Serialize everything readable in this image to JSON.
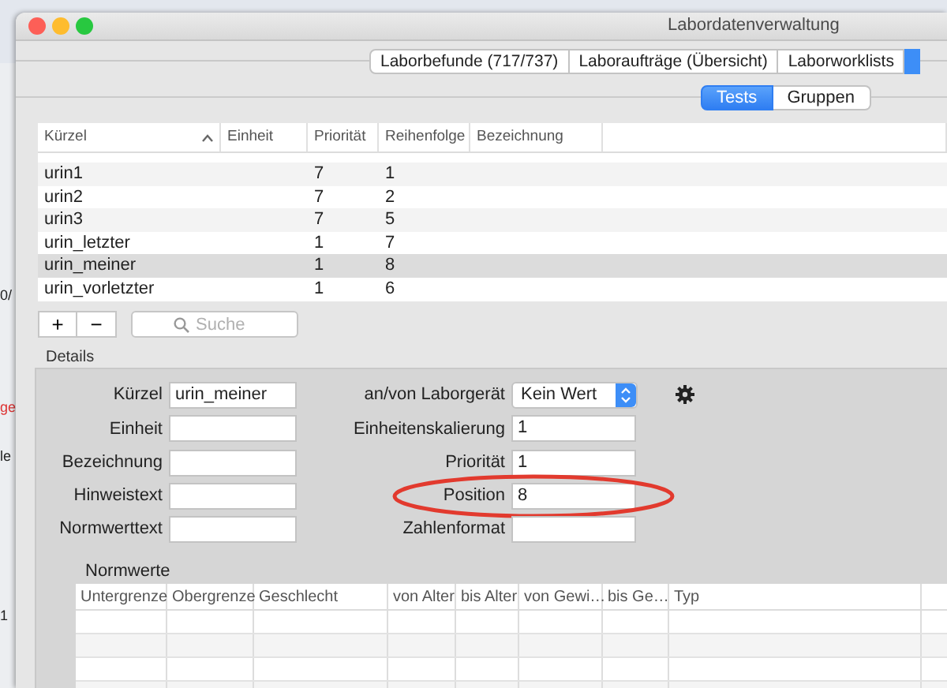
{
  "window": {
    "title": "Labordatenverwaltung"
  },
  "background_window": {
    "fragments": [
      {
        "text": "0/",
        "kind": "plain"
      },
      {
        "text": "ge",
        "kind": "alert"
      },
      {
        "text": "le",
        "kind": "plain"
      },
      {
        "text": "1",
        "kind": "plain"
      }
    ]
  },
  "tabs": [
    {
      "label": "Laborbefunde (717/737)",
      "selected": false
    },
    {
      "label": "Laboraufträge (Übersicht)",
      "selected": false
    },
    {
      "label": "Laborworklists",
      "selected": false
    },
    {
      "selected": true
    }
  ],
  "segments": [
    {
      "label": "Tests",
      "selected": true
    },
    {
      "label": "Gruppen",
      "selected": false
    }
  ],
  "tests_table": {
    "columns": [
      {
        "label": "Kürzel",
        "sorted": true
      },
      {
        "label": "Einheit",
        "sorted": false
      },
      {
        "label": "Priorität",
        "sorted": false
      },
      {
        "label": "Reihenfolge",
        "sorted": false
      },
      {
        "label": "Bezeichnung",
        "sorted": false
      }
    ],
    "rows": [
      {
        "kuerzel": "urin1",
        "prioritaet": "7",
        "reihenfolge": "1",
        "selected": false
      },
      {
        "kuerzel": "urin2",
        "prioritaet": "7",
        "reihenfolge": "2",
        "selected": false
      },
      {
        "kuerzel": "urin3",
        "prioritaet": "7",
        "reihenfolge": "5",
        "selected": false
      },
      {
        "kuerzel": "urin_letzter",
        "prioritaet": "1",
        "reihenfolge": "7",
        "selected": false
      },
      {
        "kuerzel": "urin_meiner",
        "prioritaet": "1",
        "reihenfolge": "8",
        "selected": true
      },
      {
        "kuerzel": "urin_vorletzter",
        "prioritaet": "1",
        "reihenfolge": "6",
        "selected": false
      }
    ]
  },
  "table_toolbar": {
    "add": "+",
    "remove": "−",
    "search": {
      "placeholder": "Suche"
    }
  },
  "details": {
    "title": "Details",
    "left_fields": [
      {
        "label": "Kürzel",
        "value": "urin_meiner"
      },
      {
        "label": "Einheit"
      },
      {
        "label": "Bezeichnung"
      },
      {
        "label": "Hinweistext"
      },
      {
        "label": "Normwerttext"
      }
    ],
    "right_fields": [
      {
        "label": "an/von Laborgerät",
        "kind": "popup",
        "value": "Kein Wert",
        "highlighted": false
      },
      {
        "label": "Einheitenskalierung",
        "kind": "text",
        "value": "1",
        "highlighted": false
      },
      {
        "label": "Priorität",
        "kind": "text",
        "value": "1",
        "highlighted": false
      },
      {
        "label": "Position",
        "kind": "text",
        "value": "8",
        "highlighted": true
      },
      {
        "label": "Zahlenformat",
        "kind": "text",
        "highlighted": false
      }
    ]
  },
  "normwerte": {
    "title": "Normwerte",
    "columns": [
      "Untergrenze",
      "Obergrenze",
      "Geschlecht",
      "von Alter",
      "bis Alter",
      "von Gewi…",
      "bis Ge…",
      "Typ"
    ]
  }
}
